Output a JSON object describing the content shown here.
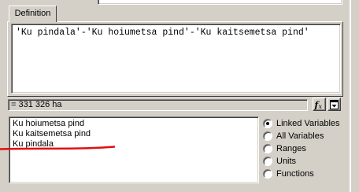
{
  "tabs": [
    {
      "label": "Definition"
    }
  ],
  "expression": {
    "text": "'Ku pindala'-'Ku hoiumetsa pind'-'Ku kaitsemetsa pind'"
  },
  "result": {
    "text": "= 331 326 ha"
  },
  "toolbar": {
    "function_icon": "function-icon",
    "insert_icon": "insert-down-icon"
  },
  "variables": {
    "items": [
      "Ku hoiumetsa pind",
      "Ku kaitsemetsa pind",
      "Ku pindala"
    ]
  },
  "filter": {
    "options": [
      {
        "label": "Linked Variables",
        "selected": true
      },
      {
        "label": "All Variables",
        "selected": false
      },
      {
        "label": "Ranges",
        "selected": false
      },
      {
        "label": "Units",
        "selected": false
      },
      {
        "label": "Functions",
        "selected": false
      }
    ]
  },
  "colors": {
    "face": "#d4d0c8",
    "annotation": "#e01010"
  }
}
